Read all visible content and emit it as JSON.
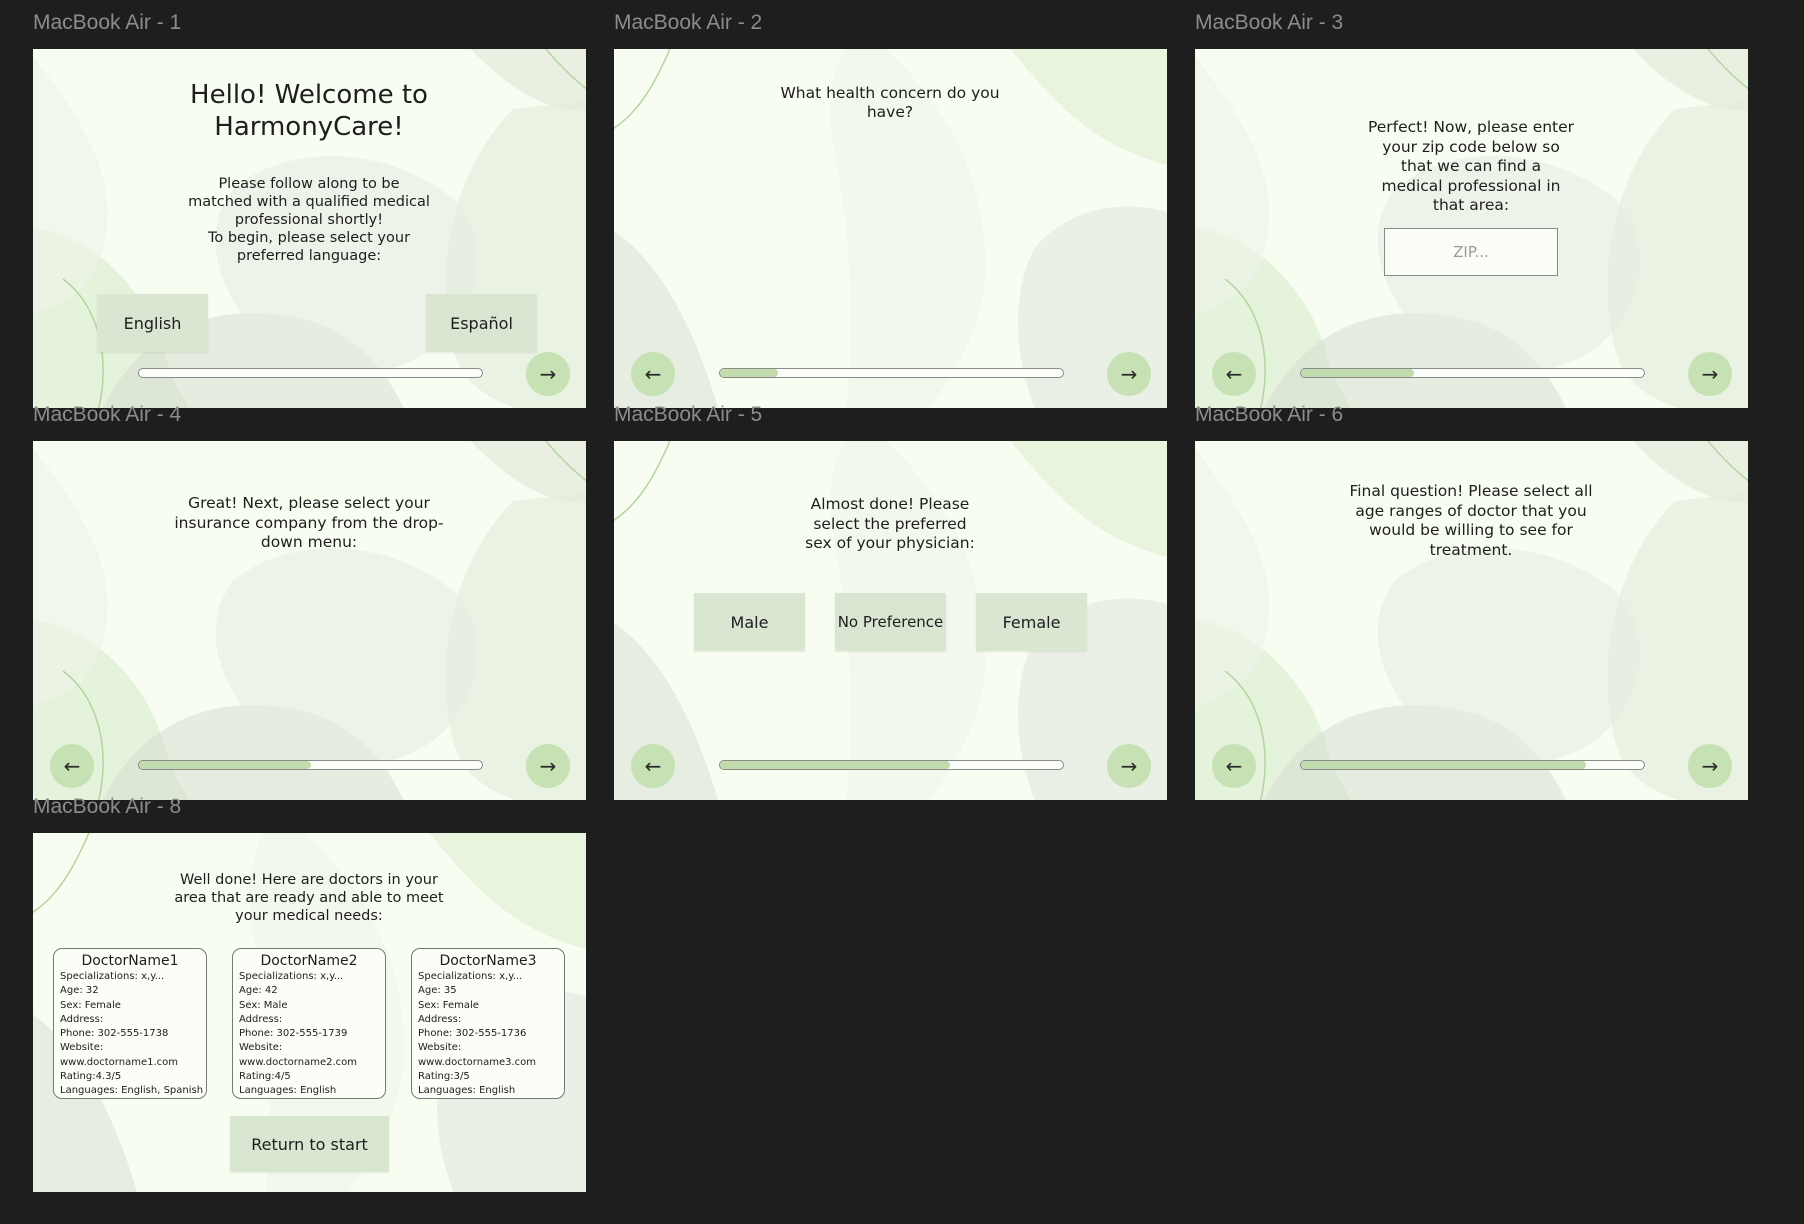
{
  "frames": {
    "f1": {
      "label": "MacBook Air - 1",
      "title": "Hello! Welcome to\nHarmonyCare!",
      "body": "Please follow along to be\nmatched with a qualified medical\nprofessional shortly!\nTo begin, please select your\npreferred language:",
      "english_label": "English",
      "espanol_label": "Español",
      "next_icon": "→",
      "progress": 0
    },
    "f2": {
      "label": "MacBook Air - 2",
      "question": "What health concern do you\nhave?",
      "back_icon": "←",
      "next_icon": "→",
      "progress": 0.17
    },
    "f3": {
      "label": "MacBook Air - 3",
      "question": "Perfect! Now, please enter\nyour zip code below so\nthat we can find a\nmedical professional in\nthat area:",
      "zip_placeholder": "ZIP...",
      "back_icon": "←",
      "next_icon": "→",
      "progress": 0.33
    },
    "f4": {
      "label": "MacBook Air - 4",
      "question": "Great! Next, please select your\ninsurance company from the drop-\ndown menu:",
      "back_icon": "←",
      "next_icon": "→",
      "progress": 0.5
    },
    "f5": {
      "label": "MacBook Air - 5",
      "question": "Almost done! Please\nselect the preferred\nsex of your physician:",
      "male_label": "Male",
      "nopref_label": "No Preference",
      "female_label": "Female",
      "back_icon": "←",
      "next_icon": "→",
      "progress": 0.67
    },
    "f6": {
      "label": "MacBook Air - 6",
      "question": "Final question! Please select all\nage ranges of doctor that you\nwould be willing to see for\ntreatment.",
      "back_icon": "←",
      "next_icon": "→",
      "progress": 0.83
    },
    "f8": {
      "label": "MacBook Air - 8",
      "intro": "Well done! Here are doctors in your\narea that are ready and able to meet\nyour medical needs:",
      "doctors": [
        {
          "name": "DoctorName1",
          "specializations": "Specializations: x,y...",
          "age": "Age: 32",
          "sex": "Sex: Female",
          "address": "Address:",
          "phone": "Phone: 302-555-1738",
          "website_label": "Website:",
          "website": "www.doctorname1.com",
          "rating": "Rating:4.3/5",
          "languages": "Languages: English, Spanish"
        },
        {
          "name": "DoctorName2",
          "specializations": "Specializations: x,y...",
          "age": "Age: 42",
          "sex": "Sex: Male",
          "address": "Address:",
          "phone": "Phone: 302-555-1739",
          "website_label": "Website:",
          "website": "www.doctorname2.com",
          "rating": "Rating:4/5",
          "languages": "Languages: English"
        },
        {
          "name": "DoctorName3",
          "specializations": "Specializations: x,y...",
          "age": "Age: 35",
          "sex": "Sex: Female",
          "address": "Address:",
          "phone": "Phone: 302-555-1736",
          "website_label": "Website:",
          "website": "www.doctorname3.com",
          "rating": "Rating:3/5",
          "languages": "Languages: English"
        }
      ],
      "return_label": "Return to start"
    }
  },
  "colors": {
    "canvas": "#1e1e1e",
    "frame_bg": "#f8fdf1",
    "button_bg": "#d9e6d2",
    "circle_button": "#c6e1b3",
    "progress_fill": "#c2dcae",
    "label_gray": "#8c8c8c"
  }
}
